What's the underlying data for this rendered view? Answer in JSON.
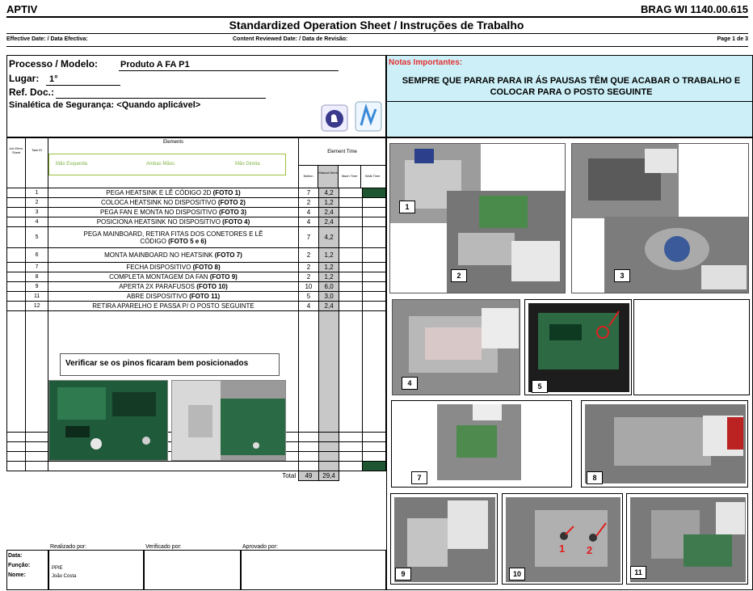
{
  "header": {
    "brand": "APTIV",
    "doc_id": "BRAG WI 1140.00.615",
    "title": "Standardized Operation Sheet / Instruções de Trabalho",
    "effective_date_label": "Effective Date: / Data Efectiva:",
    "reviewed_date_label": "Content Reviewed Date: / Data de Revisão:",
    "page": "Page 1 de 3"
  },
  "info": {
    "process_label": "Processo / Modelo:",
    "process_value": "Produto A FA P1",
    "place_label": "Lugar:",
    "place_value": "1°",
    "ref_label": "Ref. Doc.:",
    "safety_label": "Sinalética de Segurança: <Quando aplicável>"
  },
  "notes": {
    "title": "Notas Importantes:",
    "body": "SEMPRE QUE PARAR PARA IR ÁS PAUSAS TÊM QUE ACABAR O TRABALHO E COLOCAR PARA O POSTO SEGUINTE"
  },
  "table": {
    "col_job": "Job Elem. Sheet",
    "col_task": "Task ID",
    "col_elements": "Elements",
    "col_element_time": "Element Time",
    "col_motion": "Motion",
    "col_manual": "Manual Work",
    "col_mach": "Mach Time",
    "col_walk": "Walk Time",
    "legend_left": "Mão Esquerda",
    "legend_both": "Ambas Mãos",
    "legend_right": "Mão Direita",
    "steps": [
      {
        "id": "1",
        "text": "PEGA HEATSINK E LÊ CÓDIGO 2D",
        "bold": "(FOTO 1)",
        "motion": "7",
        "manual": "4,2"
      },
      {
        "id": "2",
        "text": "COLOCA HEATSINK NO DISPOSITIVO",
        "bold": "(FOTO 2)",
        "motion": "2",
        "manual": "1,2"
      },
      {
        "id": "3",
        "text": "PEGA FAN E MONTA NO DISPOSITIVO",
        "bold": "(FOTO 3)",
        "motion": "4",
        "manual": "2,4"
      },
      {
        "id": "4",
        "text": "POSICIONA HEATSINK NO DISPOSITIVO",
        "bold": "(FOTO 4)",
        "motion": "4",
        "manual": "2,4"
      },
      {
        "id": "5",
        "text": "PEGA MAINBOARD, RETIRA FITAS DOS CONETORES E LÊ CÓDIGO",
        "bold": "(FOTO 5 e 6)",
        "motion": "7",
        "manual": "4,2"
      },
      {
        "id": "6",
        "text": "MONTA MAINBOARD NO HEATSINK",
        "bold": "(FOTO 7)",
        "motion": "2",
        "manual": "1,2"
      },
      {
        "id": "7",
        "text": "FECHA DISPOSITIVO",
        "bold": "(FOTO 8)",
        "motion": "2",
        "manual": "1,2"
      },
      {
        "id": "8",
        "text": "COMPLETA MONTAGEM DA FAN",
        "bold": "(FOTO 9)",
        "motion": "2",
        "manual": "1,2"
      },
      {
        "id": "9",
        "text": "APERTA 2X PARAFUSOS",
        "bold": "(FOTO 10)",
        "motion": "10",
        "manual": "6,0"
      },
      {
        "id": "11",
        "text": "ABRE DISPOSITIVO",
        "bold": "(FOTO 11)",
        "motion": "5",
        "manual": "3,0"
      },
      {
        "id": "12",
        "text": "RETIRA APARELHO E PASSA P/ O POSTO SEGUINTE",
        "bold": "",
        "motion": "4",
        "manual": "2,4"
      }
    ],
    "total_label": "Total",
    "total_motion": "49",
    "total_manual": "29,4"
  },
  "verify_note": "Verificar se os pinos ficaram bem posicionados",
  "signatures": {
    "done_by": "Realizado por:",
    "verified_by": "Verificado por:",
    "approved_by": "Aprovado por:",
    "date_label": "Data:",
    "function_label": "Função:",
    "name_label": "Nome:",
    "function_value": "PPIE",
    "name_value": "João Costa"
  },
  "photos": [
    "1",
    "2",
    "3",
    "4",
    "5",
    "7",
    "8",
    "9",
    "10",
    "11"
  ],
  "colors": {
    "notes_bg": "#cdf0f8",
    "notes_title": "#e23030",
    "legend": "#7cb342",
    "manual_col": "#c8c8c8",
    "marker": "#1e5632"
  }
}
